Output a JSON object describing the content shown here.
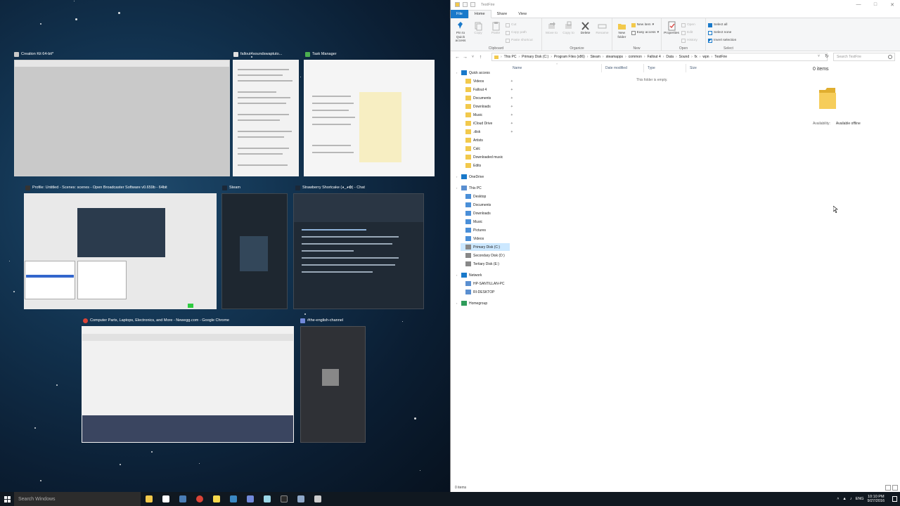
{
  "task_view": {
    "windows": [
      {
        "title": "Creation Kit 64-bit*"
      },
      {
        "title": "fallout4soundswaptuto..."
      },
      {
        "title": "Task Manager"
      },
      {
        "title": "Profile: Untitled - Scenes: scenes - Open Broadcaster Software v0.659b - 64bit"
      },
      {
        "title": "Steam"
      },
      {
        "title": "Strawberry Shortcake (◕_◕✿) - Chat"
      },
      {
        "title": "Computer Parts, Laptops, Electronics, and More - Newegg.com - Google Chrome"
      },
      {
        "title": "#the-english-channel"
      }
    ]
  },
  "explorer": {
    "window_title": "TestFire",
    "tabs": {
      "file": "File",
      "home": "Home",
      "share": "Share",
      "view": "View"
    },
    "ribbon": {
      "clipboard": {
        "pin": "Pin to Quick access",
        "copy": "Copy",
        "paste": "Paste",
        "cut": "Cut",
        "copy_path": "Copy path",
        "paste_shortcut": "Paste shortcut",
        "label": "Clipboard"
      },
      "organize": {
        "move_to": "Move to",
        "copy_to": "Copy to",
        "delete": "Delete",
        "rename": "Rename",
        "label": "Organize"
      },
      "new": {
        "new_folder": "New folder",
        "new_item": "New item",
        "easy_access": "Easy access",
        "label": "New"
      },
      "open": {
        "properties": "Properties",
        "open": "Open",
        "edit": "Edit",
        "history": "History",
        "label": "Open"
      },
      "select": {
        "select_all": "Select all",
        "select_none": "Select none",
        "invert": "Invert selection",
        "label": "Select"
      }
    },
    "address": {
      "crumbs": [
        "This PC",
        "Primary Disk (C:)",
        "Program Files (x86)",
        "Steam",
        "steamapps",
        "common",
        "Fallout 4",
        "Data",
        "Sound",
        "fx",
        "wpn",
        "TestFire"
      ],
      "search_placeholder": "Search TestFire"
    },
    "nav": {
      "quick_access": "Quick access",
      "quick_items": [
        {
          "label": "Videos",
          "pinned": true
        },
        {
          "label": "Fallout 4",
          "pinned": true
        },
        {
          "label": "Documents",
          "pinned": true
        },
        {
          "label": "Downloads",
          "pinned": true
        },
        {
          "label": "Music",
          "pinned": true
        },
        {
          "label": "iCloud Drive",
          "pinned": true
        },
        {
          "label": ".disk",
          "pinned": true
        },
        {
          "label": "Artists",
          "pinned": false
        },
        {
          "label": "Calc",
          "pinned": false
        },
        {
          "label": "Downloaded music",
          "pinned": false
        },
        {
          "label": "Edits",
          "pinned": false
        }
      ],
      "onedrive": "OneDrive",
      "this_pc": "This PC",
      "pc_items": [
        "Desktop",
        "Documents",
        "Downloads",
        "Music",
        "Pictures",
        "Videos",
        "Primary Disk (C:)",
        "Secondary Disk (D:)",
        "Tertiary Disk (E:)"
      ],
      "network": "Network",
      "network_items": [
        "HP-SANTILLAN-PC",
        "RI-DESKTOP"
      ],
      "homegroup": "Homegroup"
    },
    "columns": {
      "name": "Name",
      "date": "Date modified",
      "type": "Type",
      "size": "Size"
    },
    "empty_message": "This folder is empty.",
    "preview": {
      "count": "0 items",
      "availability_label": "Availability:",
      "availability_value": "Available offline"
    },
    "status": "0 items"
  },
  "taskbar": {
    "search_placeholder": "Search Windows",
    "lang": "ENG",
    "time": "10:10 PM",
    "date": "9/27/2016"
  },
  "colors": {
    "accent": "#1979ca",
    "folder": "#f2c94c",
    "taskbar": "#101820"
  }
}
